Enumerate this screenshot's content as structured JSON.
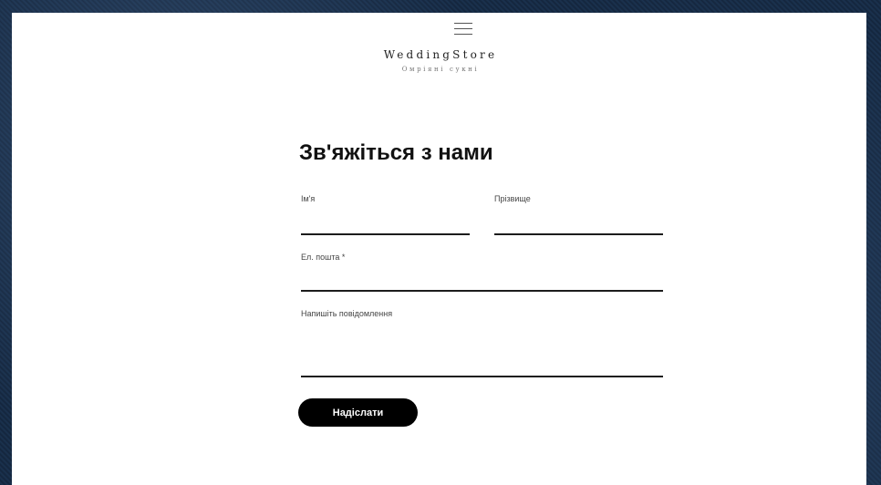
{
  "header": {
    "menu_icon": "hamburger-menu-icon",
    "brand": "WeddingStore",
    "tagline": "Омрiянi сукнi"
  },
  "form": {
    "title": "Зв'яжіться з нами",
    "first_name_label": "Ім'я",
    "last_name_label": "Прізвище",
    "email_label": "Ел. пошта *",
    "message_label": "Напишіть повідомлення",
    "first_name_value": "",
    "last_name_value": "",
    "email_value": "",
    "message_value": "",
    "submit_label": "Надіслати"
  },
  "colors": {
    "background_texture": "#162b44",
    "panel": "#ffffff",
    "button": "#000000",
    "button_text": "#ffffff",
    "underline": "#1c1c1c"
  }
}
